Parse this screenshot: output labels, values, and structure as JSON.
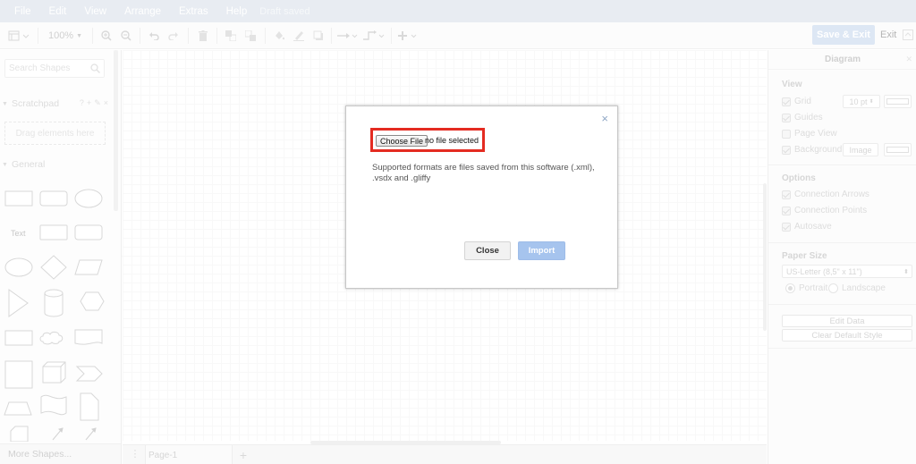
{
  "menubar": {
    "items": [
      "File",
      "Edit",
      "View",
      "Arrange",
      "Extras",
      "Help"
    ],
    "status": "Draft saved"
  },
  "toolbar": {
    "zoom": "100%",
    "save_exit": "Save & Exit",
    "exit": "Exit"
  },
  "sidebar": {
    "search_placeholder": "Search Shapes",
    "scratchpad": {
      "title": "Scratchpad",
      "drop_hint": "Drag elements here"
    },
    "general": {
      "title": "General",
      "text_shape_label": "Text"
    },
    "more_shapes": "More Shapes..."
  },
  "pages": {
    "current": "Page-1"
  },
  "format_panel": {
    "title": "Diagram",
    "view": {
      "heading": "View",
      "grid": {
        "label": "Grid",
        "checked": true,
        "size": "10 pt"
      },
      "guides": {
        "label": "Guides",
        "checked": true
      },
      "page_view": {
        "label": "Page View",
        "checked": false
      },
      "background": {
        "label": "Background",
        "checked": true,
        "image_button": "Image"
      }
    },
    "options": {
      "heading": "Options",
      "connection_arrows": {
        "label": "Connection Arrows",
        "checked": true
      },
      "connection_points": {
        "label": "Connection Points",
        "checked": true
      },
      "autosave": {
        "label": "Autosave",
        "checked": true
      }
    },
    "paper_size": {
      "heading": "Paper Size",
      "selected": "US-Letter (8,5\" x 11\")",
      "portrait": "Portrait",
      "landscape": "Landscape",
      "orientation": "Portrait"
    },
    "edit_data": "Edit Data",
    "clear_default_style": "Clear Default Style"
  },
  "dialog": {
    "close_icon": "×",
    "file_button": "Choose File",
    "file_status": "no file selected",
    "description": "Supported formats are files saved from this software (.xml), .vsdx and .gliffy",
    "close_button": "Close",
    "import_button": "Import"
  },
  "colors": {
    "menubar_bg": "#d5dde7",
    "highlight_border": "#e42b21",
    "import_button": "#a6c4ee",
    "save_exit": "#c2d4ec"
  }
}
